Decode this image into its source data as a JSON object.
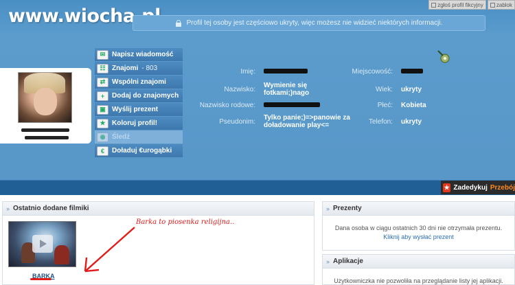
{
  "watermark": "www.wiocha.pl",
  "topbar": {
    "report_label": "zgłoś profil fikcyjny",
    "block_label": "zablok"
  },
  "notice": {
    "text": "Profil tej osoby jest częściowo ukryty, więc możesz nie widzieć niektórych informacji."
  },
  "actions": [
    {
      "label": "Napisz wiadomość",
      "icon": "envelope-icon"
    },
    {
      "label": "Znajomi",
      "count": " - 803",
      "icon": "friends-icon"
    },
    {
      "label": "Wspólni znajomi",
      "icon": "mutual-friends-icon"
    },
    {
      "label": "Dodaj do znajomych",
      "icon": "add-friend-icon"
    },
    {
      "label": "Wyślij prezent",
      "icon": "gift-icon"
    },
    {
      "label": "Koloruj profil!",
      "icon": "palette-icon"
    },
    {
      "label": "Śledź",
      "icon": "follow-icon",
      "disabled": true
    },
    {
      "label": "Doładuj €urogąbki",
      "icon": "currency-icon"
    }
  ],
  "info": {
    "name_label": "Imię:",
    "surname_label": "Nazwisko:",
    "surname_value": "Wymienie się fotkami;)nago",
    "family_name_label": "Nazwisko rodowe:",
    "nickname_label": "Pseudonim:",
    "nickname_value": "Tylko panie;)=>panowie za doładowanie play<=",
    "city_label": "Miejscowość:",
    "age_label": "Wiek:",
    "age_value": "ukryty",
    "gender_label": "Płeć:",
    "gender_value": "Kobieta",
    "phone_label": "Telefon:",
    "phone_value": "ukryty"
  },
  "promo": {
    "label_main": "Zadedykuj",
    "label_accent": "Przebój"
  },
  "videos_panel": {
    "title": "Ostatnio dodane filmiki",
    "video_title": "BARKA"
  },
  "annotation": "Barka to piosenka religijna..",
  "gifts_panel": {
    "title": "Prezenty",
    "text": "Dana osoba w ciągu ostatnich 30 dni nie otrzymała prezentu.",
    "link": "Kliknij aby wysłać prezent"
  },
  "apps_panel": {
    "title": "Aplikacje",
    "text": "Użytkowniczka nie pozwoliła na przeglądanie listy jej aplikacji."
  },
  "colors": {
    "header_blue": "#5897c8",
    "promo_bar": "#1f5f95",
    "annotation_red": "#e21b1b",
    "link_blue": "#2a6db3"
  }
}
